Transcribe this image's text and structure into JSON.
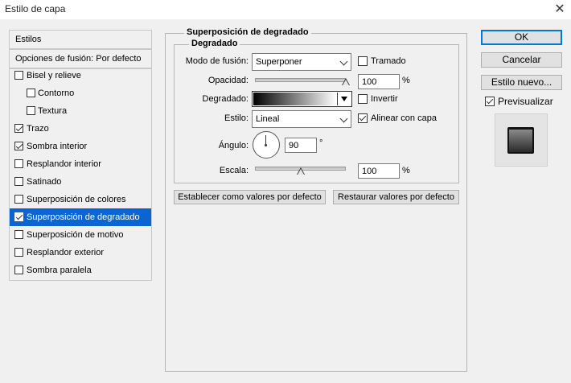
{
  "window": {
    "title": "Estilo de capa",
    "close_icon": "close-icon"
  },
  "styles_panel": {
    "header": "Estilos",
    "blending": "Opciones de fusión: Por defecto",
    "items": [
      {
        "label": "Bisel y relieve",
        "checked": false,
        "indent": false,
        "selected": false
      },
      {
        "label": "Contorno",
        "checked": false,
        "indent": true,
        "selected": false
      },
      {
        "label": "Textura",
        "checked": false,
        "indent": true,
        "selected": false
      },
      {
        "label": "Trazo",
        "checked": true,
        "indent": false,
        "selected": false
      },
      {
        "label": "Sombra interior",
        "checked": true,
        "indent": false,
        "selected": false
      },
      {
        "label": "Resplandor interior",
        "checked": false,
        "indent": false,
        "selected": false
      },
      {
        "label": "Satinado",
        "checked": false,
        "indent": false,
        "selected": false
      },
      {
        "label": "Superposición de colores",
        "checked": false,
        "indent": false,
        "selected": false
      },
      {
        "label": "Superposición de degradado",
        "checked": true,
        "indent": false,
        "selected": true
      },
      {
        "label": "Superposición de motivo",
        "checked": false,
        "indent": false,
        "selected": false
      },
      {
        "label": "Resplandor exterior",
        "checked": false,
        "indent": false,
        "selected": false
      },
      {
        "label": "Sombra paralela",
        "checked": false,
        "indent": false,
        "selected": false
      }
    ]
  },
  "gradient_overlay": {
    "title": "Superposición de degradado",
    "group": "Degradado",
    "blend_mode_label": "Modo de fusión:",
    "blend_mode_value": "Superponer",
    "dither_label": "Tramado",
    "dither_checked": false,
    "opacity_label": "Opacidad:",
    "opacity_value": "100",
    "opacity_unit": "%",
    "opacity_level": 1.0,
    "gradient_label": "Degradado:",
    "reverse_label": "Invertir",
    "reverse_checked": false,
    "style_label": "Estilo:",
    "style_value": "Lineal",
    "align_label": "Alinear con capa",
    "align_checked": true,
    "angle_label": "Ángulo:",
    "angle_value": "90",
    "angle_unit": "°",
    "scale_label": "Escala:",
    "scale_value": "100",
    "scale_unit": "%",
    "scale_level": 0.5,
    "set_default_label": "Establecer como valores por defecto",
    "reset_default_label": "Restaurar valores por defecto"
  },
  "actions": {
    "ok": "OK",
    "cancel": "Cancelar",
    "new_style": "Estilo nuevo...",
    "preview_label": "Previsualizar",
    "preview_checked": true
  },
  "colors": {
    "selection": "#0a64d2",
    "accent": "#0078d7",
    "background": "#f0f0f0"
  }
}
